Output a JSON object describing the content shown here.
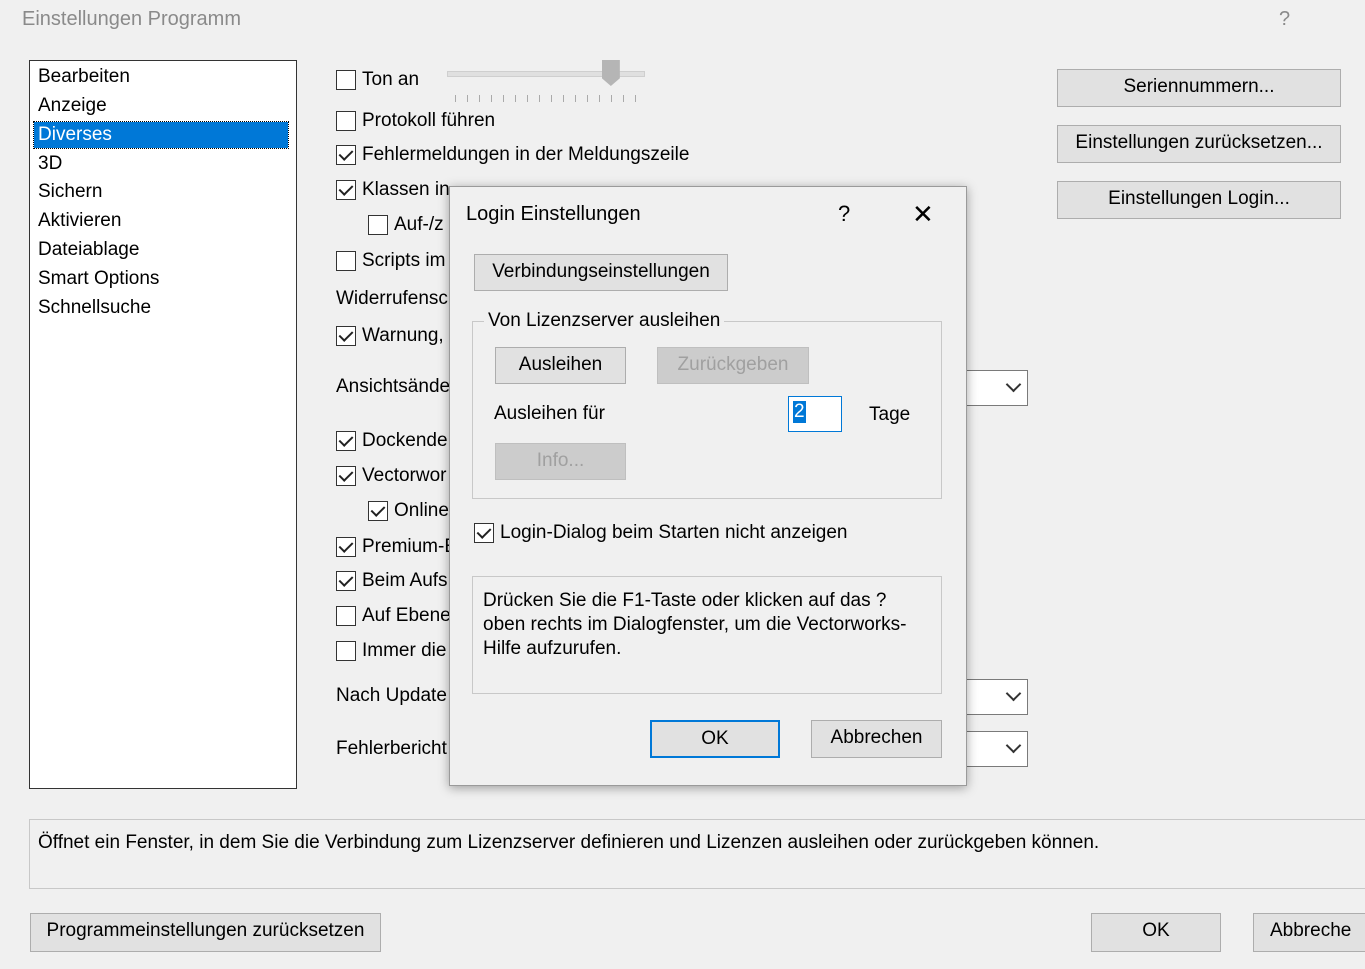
{
  "window": {
    "title": "Einstellungen Programm",
    "help": "?"
  },
  "sidebar": {
    "items": [
      {
        "label": "Bearbeiten"
      },
      {
        "label": "Anzeige"
      },
      {
        "label": "Diverses",
        "selected": true
      },
      {
        "label": "3D"
      },
      {
        "label": "Sichern"
      },
      {
        "label": "Aktivieren"
      },
      {
        "label": "Dateiablage"
      },
      {
        "label": "Smart Options"
      },
      {
        "label": "Schnellsuche"
      }
    ]
  },
  "options": {
    "ton_an": {
      "label": "Ton an",
      "checked": false
    },
    "volume_level": 0.87,
    "protokoll": {
      "label": "Protokoll führen",
      "checked": false
    },
    "fehlermeldungen": {
      "label": "Fehlermeldungen in der Meldungszeile",
      "checked": true
    },
    "klassen": {
      "label": "Klassen in",
      "checked": true
    },
    "auf_z": {
      "label": "Auf-/z",
      "checked": false
    },
    "scripts": {
      "label": "Scripts im",
      "checked": false
    },
    "widerrufen_label": "Widerrufensc",
    "warnung": {
      "label": "Warnung,",
      "checked": true
    },
    "ansichts_label": "Ansichtsände",
    "dockende": {
      "label": "Dockende",
      "checked": true
    },
    "vectorwo": {
      "label": "Vectorwor",
      "checked": true
    },
    "online": {
      "label": "Online",
      "checked": true
    },
    "premium": {
      "label": "Premium-E",
      "checked": true
    },
    "beim_aufs": {
      "label": "Beim Aufs",
      "checked": true
    },
    "auf_ebene": {
      "label": "Auf Ebene",
      "checked": false
    },
    "immer_die": {
      "label": "Immer die",
      "checked": false
    },
    "nach_update_label": "Nach Update",
    "fehlerbericht_label": "Fehlerbericht"
  },
  "right_buttons": {
    "seriennummern": "Seriennummern...",
    "reset": "Einstellungen zurücksetzen...",
    "login": "Einstellungen Login..."
  },
  "status_text": "Öffnet ein Fenster, in dem Sie die Verbindung zum Lizenzserver definieren und Lizenzen ausleihen oder zurückgeben können.",
  "bottom": {
    "reset_program": "Programmeinstellungen zurücksetzen",
    "ok": "OK",
    "cancel": "Abbreche"
  },
  "dialog": {
    "title": "Login Einstellungen",
    "help": "?",
    "close": "✕",
    "connection_button": "Verbindungseinstellungen",
    "group_title": "Von Lizenzserver ausleihen",
    "borrow_button": "Ausleihen",
    "return_button": "Zurückgeben",
    "borrow_for_label": "Ausleihen für",
    "days_value": "2",
    "days_unit": "Tage",
    "info_button": "Info...",
    "hide_login": {
      "label": "Login-Dialog beim Starten nicht anzeigen",
      "checked": true
    },
    "help_text": "Drücken Sie die F1-Taste oder klicken auf das ? oben rechts im Dialogfenster, um die Vectorworks-Hilfe aufzurufen.",
    "ok": "OK",
    "cancel": "Abbrechen"
  }
}
